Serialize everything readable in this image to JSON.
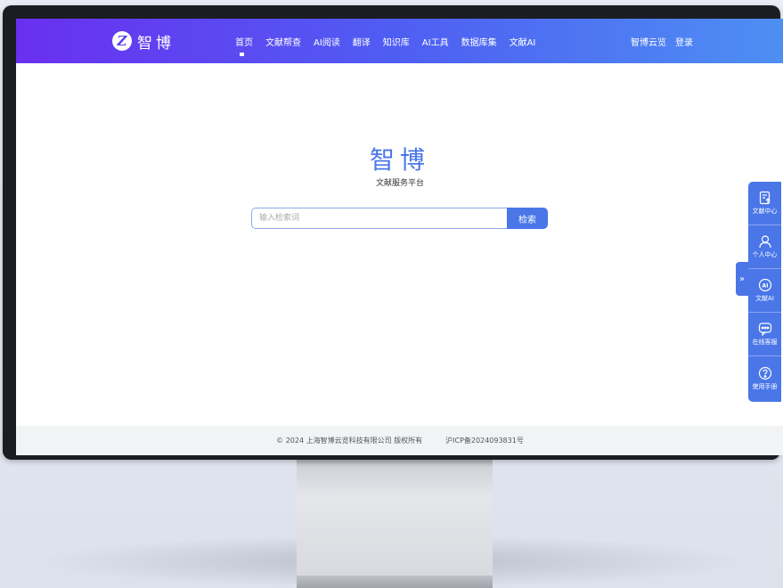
{
  "header": {
    "logo_letter": "Z",
    "logo_text": "智博",
    "nav": [
      {
        "label": "首页",
        "active": true
      },
      {
        "label": "文献帮查"
      },
      {
        "label": "AI阅读"
      },
      {
        "label": "翻译"
      },
      {
        "label": "知识库"
      },
      {
        "label": "AI工具"
      },
      {
        "label": "数据库集"
      },
      {
        "label": "文献AI"
      }
    ],
    "right_links": [
      "智博云览",
      "登录"
    ]
  },
  "main": {
    "title": "智博",
    "subtitle": "文献服务平台",
    "search": {
      "placeholder": "输入检索词",
      "button_label": "检索"
    }
  },
  "footer": {
    "copyright": "© 2024 上海智博云览科技有限公司 版权所有",
    "icp": "沪ICP备2024093831号"
  },
  "sidebar": {
    "toggle_glyph": "»",
    "items": [
      {
        "label": "文献中心",
        "icon": "document-upload-icon"
      },
      {
        "label": "个人中心",
        "icon": "user-icon"
      },
      {
        "label": "文献AI",
        "icon": "ai-icon"
      },
      {
        "label": "在线客服",
        "icon": "chat-icon"
      },
      {
        "label": "使用手册",
        "icon": "help-icon"
      }
    ]
  },
  "colors": {
    "header_gradient": [
      "#6a2ff0",
      "#4d8ff3"
    ],
    "accent": "#4a76e8"
  }
}
